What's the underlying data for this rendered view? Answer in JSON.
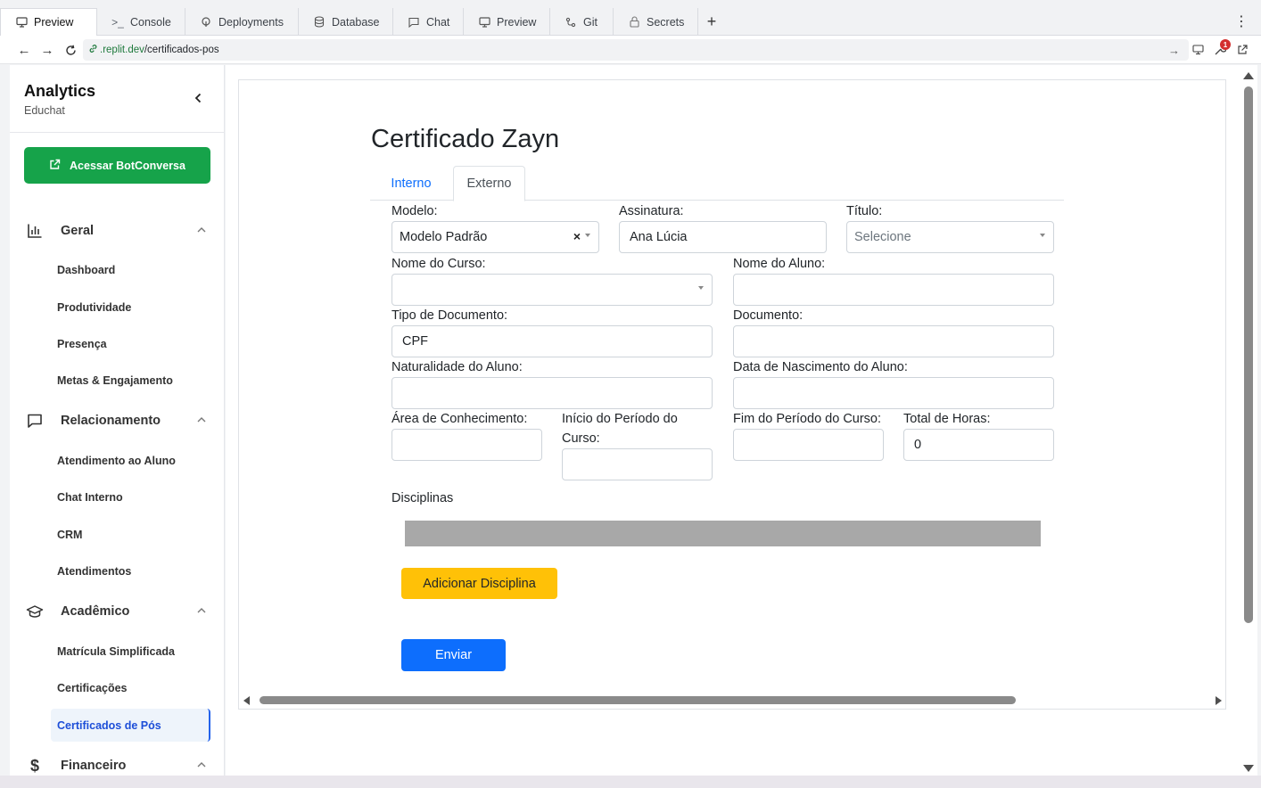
{
  "browser": {
    "tabs": [
      {
        "label": "Preview",
        "icon": "monitor-icon"
      },
      {
        "label": "Console",
        "icon": "terminal-icon"
      },
      {
        "label": "Deployments",
        "icon": "deploy-icon"
      },
      {
        "label": "Database",
        "icon": "database-icon"
      },
      {
        "label": "Chat",
        "icon": "chat-icon"
      },
      {
        "label": "Preview",
        "icon": "monitor-icon"
      },
      {
        "label": "Git",
        "icon": "git-icon"
      },
      {
        "label": "Secrets",
        "icon": "lock-icon"
      }
    ],
    "url_domain": ".replit.dev",
    "url_path": "/certificados-pos",
    "notification_count": "1"
  },
  "sidebar": {
    "title": "Analytics",
    "subtitle": "Educhat",
    "bot_button": "Acessar BotConversa",
    "sections": [
      {
        "label": "Geral",
        "items": [
          "Dashboard",
          "Produtividade",
          "Presença",
          "Metas & Engajamento"
        ]
      },
      {
        "label": "Relacionamento",
        "items": [
          "Atendimento ao Aluno",
          "Chat Interno",
          "CRM",
          "Atendimentos"
        ]
      },
      {
        "label": "Acadêmico",
        "items": [
          "Matrícula Simplificada",
          "Certificações",
          "Certificados de Pós"
        ]
      },
      {
        "label": "Financeiro",
        "items": []
      }
    ],
    "active_item": "Certificados de Pós"
  },
  "main": {
    "title": "Certificado Zayn",
    "tabs": [
      "Interno",
      "Externo"
    ],
    "active_tab": "Externo",
    "form": {
      "modelo_label": "Modelo:",
      "modelo_value": "Modelo Padrão",
      "assinatura_label": "Assinatura:",
      "assinatura_value": "Ana Lúcia",
      "titulo_label": "Título:",
      "titulo_placeholder": "Selecione",
      "curso_label": "Nome do Curso:",
      "curso_value": "",
      "aluno_label": "Nome do Aluno:",
      "aluno_value": "",
      "tipo_doc_label": "Tipo de Documento:",
      "tipo_doc_value": "CPF",
      "documento_label": "Documento:",
      "documento_value": "",
      "naturalidade_label": "Naturalidade do Aluno:",
      "naturalidade_value": "",
      "nascimento_label": "Data de Nascimento do Aluno:",
      "nascimento_value": "",
      "area_label": "Área de Conhecimento:",
      "area_value": "",
      "inicio_label_1": "Início do Período do",
      "inicio_label_2": "Curso:",
      "inicio_value": "",
      "fim_label": "Fim do Período do Curso:",
      "fim_value": "",
      "horas_label": "Total de Horas:",
      "horas_value": "0",
      "disciplinas_label": "Disciplinas",
      "add_button": "Adicionar Disciplina",
      "submit_button": "Enviar"
    }
  }
}
